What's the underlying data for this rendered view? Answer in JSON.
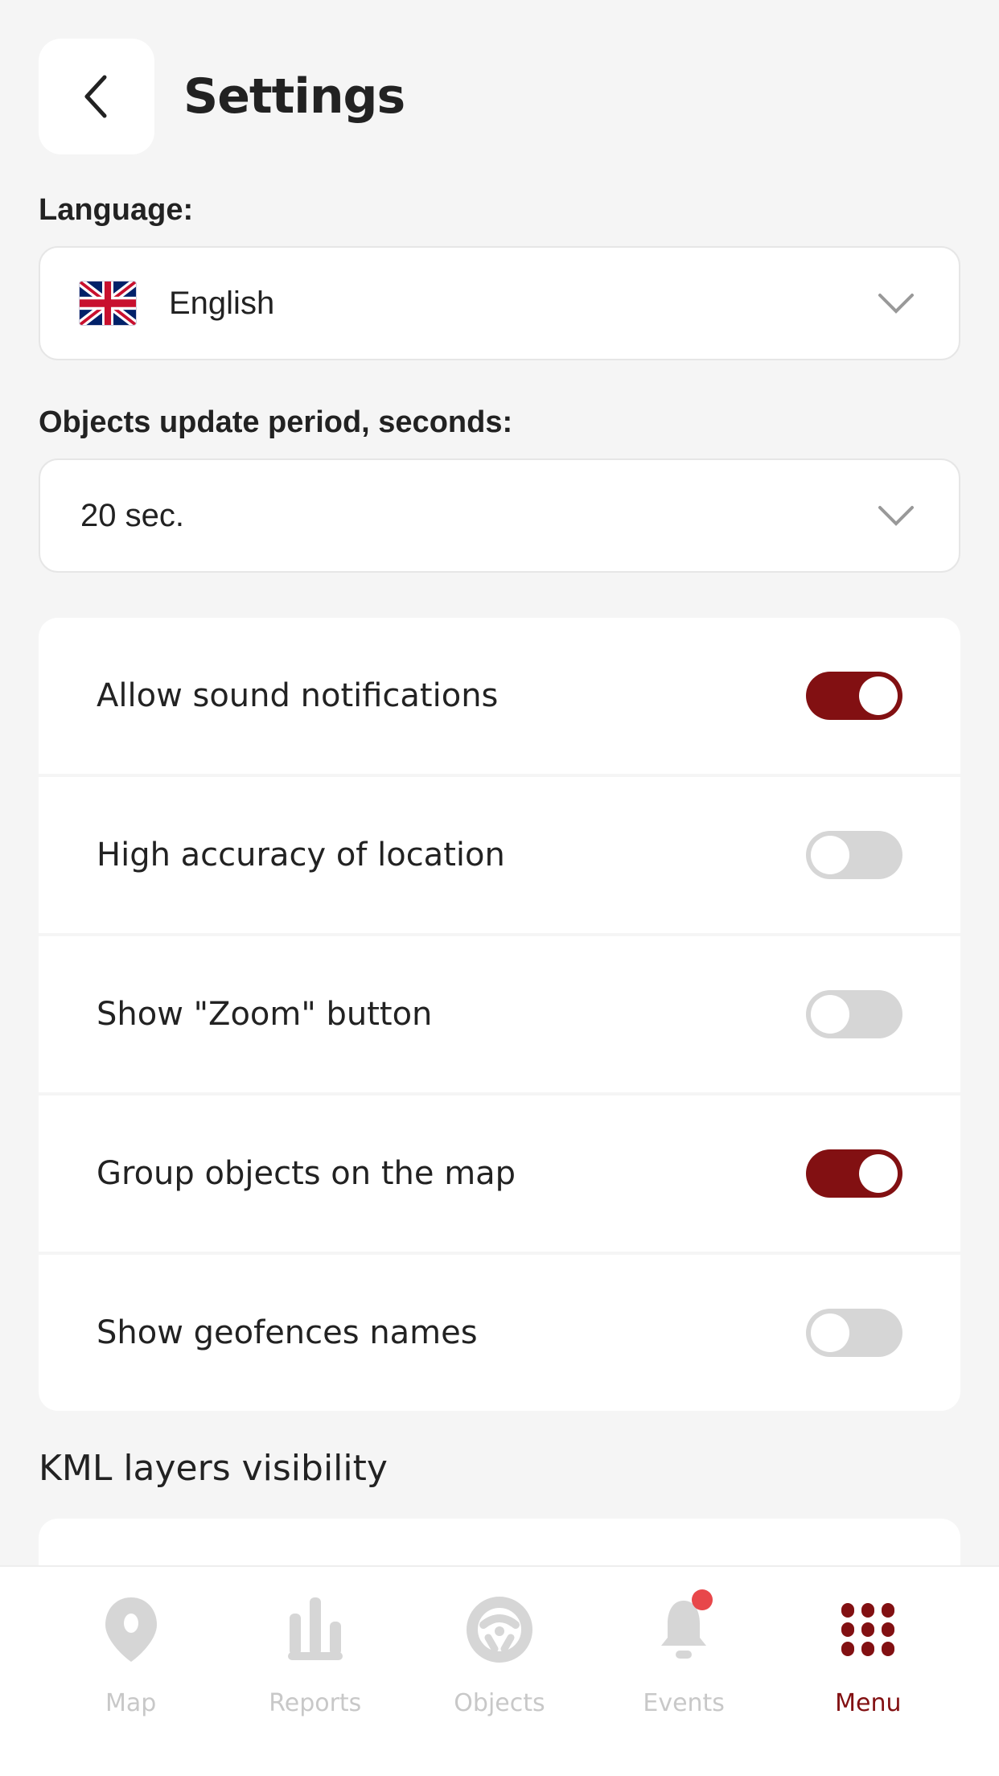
{
  "header": {
    "title": "Settings",
    "back_icon": "chevron-left-icon"
  },
  "language": {
    "label": "Language:",
    "value": "English",
    "flag_icon": "uk-flag-icon"
  },
  "update_period": {
    "label": "Objects update period, seconds:",
    "value": "20 sec."
  },
  "toggles": [
    {
      "label": "Allow sound notifications",
      "on": true
    },
    {
      "label": "High accuracy of location",
      "on": false
    },
    {
      "label": "Show \"Zoom\" button",
      "on": false
    },
    {
      "label": "Group objects on the map",
      "on": true
    },
    {
      "label": "Show geofences names",
      "on": false
    }
  ],
  "kml": {
    "title": "KML layers visibility"
  },
  "tabbar": {
    "items": [
      {
        "label": "Map",
        "icon": "map-pin-icon",
        "active": false
      },
      {
        "label": "Reports",
        "icon": "bar-chart-icon",
        "active": false
      },
      {
        "label": "Objects",
        "icon": "steering-wheel-icon",
        "active": false
      },
      {
        "label": "Events",
        "icon": "bell-icon",
        "active": false,
        "badge": true
      },
      {
        "label": "Menu",
        "icon": "grid-menu-icon",
        "active": true
      }
    ]
  },
  "colors": {
    "accent": "#821012",
    "inactive": "#d6d6d6",
    "badge": "#e8474a",
    "background": "#f5f5f5"
  }
}
